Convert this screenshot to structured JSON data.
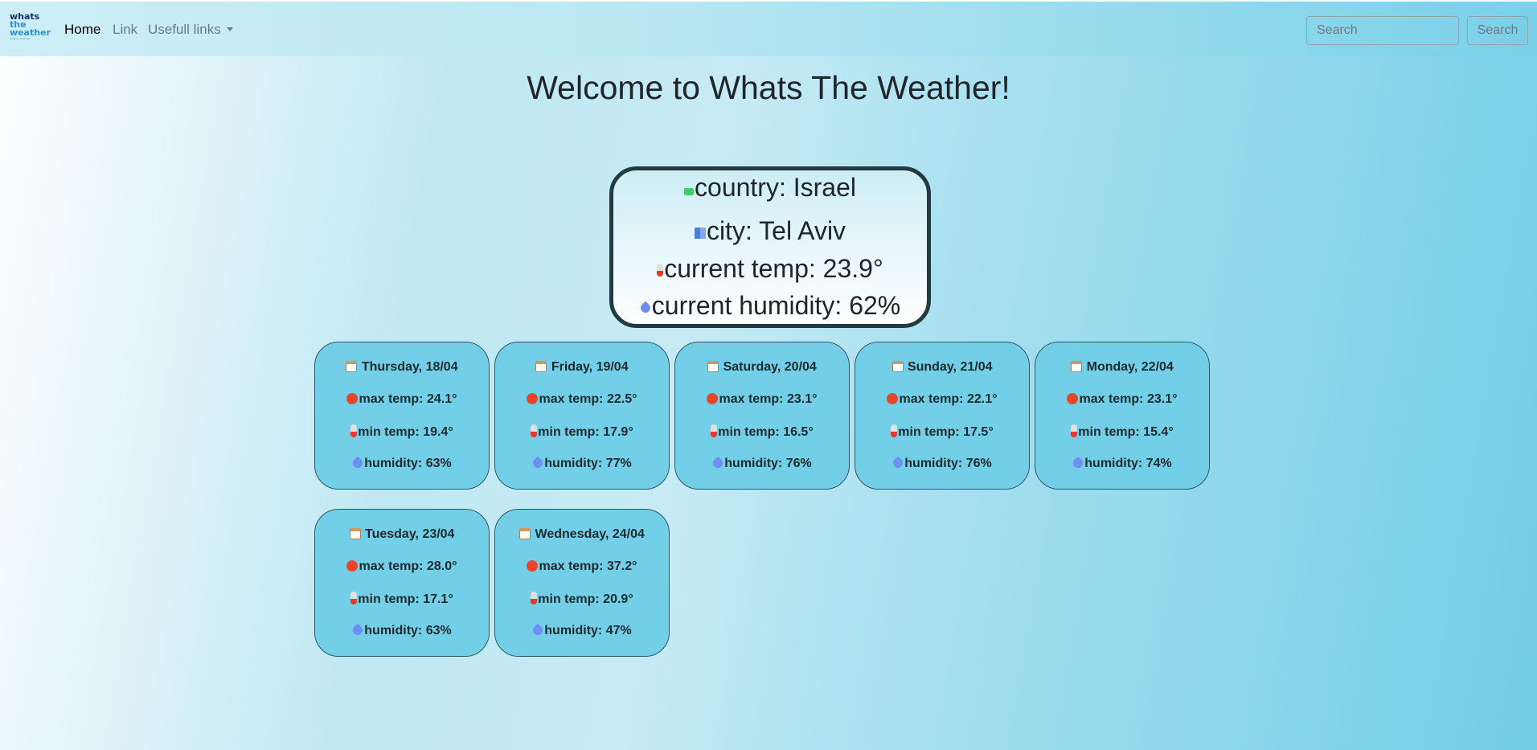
{
  "navbar": {
    "brand": {
      "line1": "whats",
      "line2": "the",
      "line3": "weather",
      "tagline": "weather forecast"
    },
    "home_label": "Home",
    "link_label": "Link",
    "useful_links_label": "Usefull links",
    "search": {
      "placeholder": "Search",
      "button_label": "Search"
    }
  },
  "page_title": "Welcome to Whats The Weather!",
  "current": {
    "country": "country: Israel",
    "city": "city: Tel Aviv",
    "temp": "current temp: 23.9°",
    "humidity": "current humidity: 62%",
    "icons": [
      "map-icon",
      "city-icon",
      "thermometer-celsius-icon",
      "droplet-icon"
    ]
  },
  "forecast": [
    {
      "date": "Thursday, 18/04",
      "max": "max temp: 24.1°",
      "min": "min temp: 19.4°",
      "humidity": "humidity: 63%"
    },
    {
      "date": "Friday, 19/04",
      "max": "max temp: 22.5°",
      "min": "min temp: 17.9°",
      "humidity": "humidity: 77%"
    },
    {
      "date": "Saturday, 20/04",
      "max": "max temp: 23.1°",
      "min": "min temp: 16.5°",
      "humidity": "humidity: 76%"
    },
    {
      "date": "Sunday, 21/04",
      "max": "max temp: 22.1°",
      "min": "min temp: 17.5°",
      "humidity": "humidity: 76%"
    },
    {
      "date": "Monday, 22/04",
      "max": "max temp: 23.1°",
      "min": "min temp: 15.4°",
      "humidity": "humidity: 74%"
    },
    {
      "date": "Tuesday, 23/04",
      "max": "max temp: 28.0°",
      "min": "min temp: 17.1°",
      "humidity": "humidity: 63%"
    },
    {
      "date": "Wednesday, 24/04",
      "max": "max temp: 37.2°",
      "min": "min temp: 20.9°",
      "humidity": "humidity: 47%"
    }
  ],
  "forecast_icons": [
    "calendar-icon",
    "hot-icon",
    "thermometer-icon",
    "droplet-icon"
  ],
  "colors": {
    "card": "#73cfe7",
    "card_border": "#32565e",
    "current_border": "#223a40",
    "text": "#212529"
  }
}
